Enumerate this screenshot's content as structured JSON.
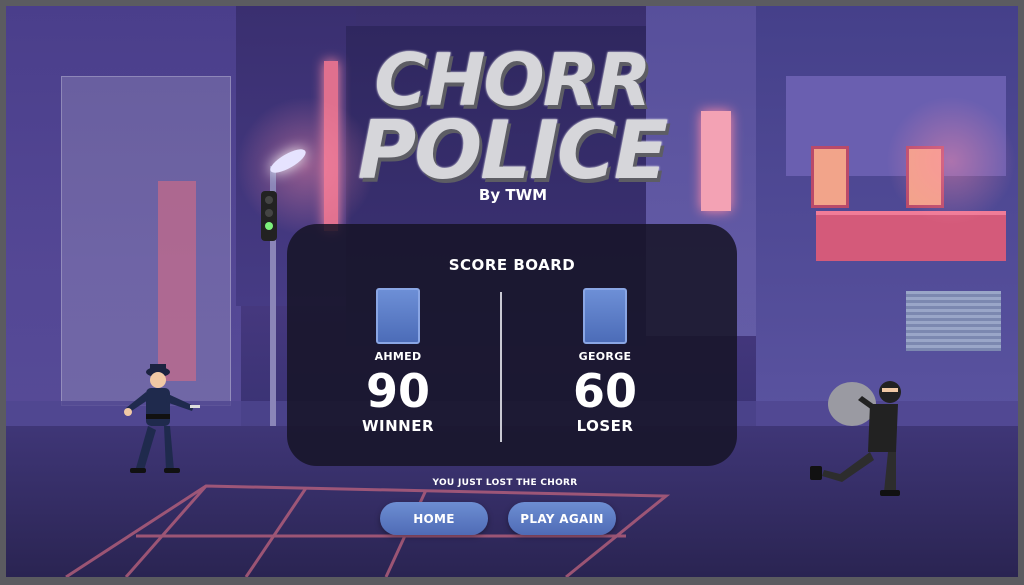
{
  "title": {
    "line1": "CHORR",
    "line2": "POLICE",
    "byline": "By TWM"
  },
  "scoreboard": {
    "heading": "SCORE BOARD",
    "players": [
      {
        "name": "AHMED",
        "score": "90",
        "result": "WINNER"
      },
      {
        "name": "GEORGE",
        "score": "60",
        "result": "LOSER"
      }
    ]
  },
  "message": "YOU JUST LOST THE CHORR",
  "buttons": {
    "home": "HOME",
    "play_again": "PLAY AGAIN"
  },
  "colors": {
    "button": "#5f7ec6",
    "panel": "#161426",
    "background": "#3f3677"
  },
  "icons": {
    "player_avatar": "player-avatar-icon",
    "cop": "police-character",
    "thief": "thief-character"
  }
}
